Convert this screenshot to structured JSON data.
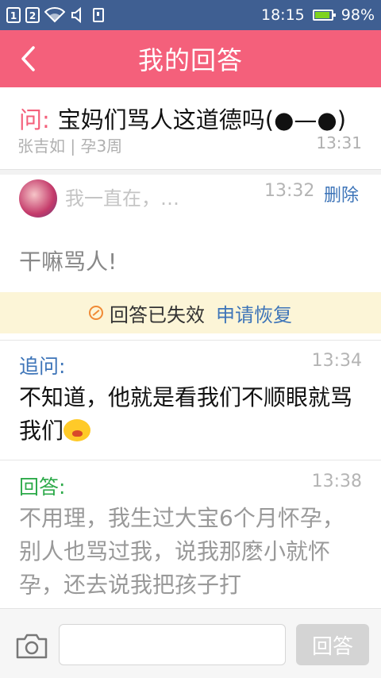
{
  "status_bar": {
    "sim1": "1",
    "sim2": "2",
    "time": "18:15",
    "battery": "98%"
  },
  "header": {
    "title": "我的回答",
    "back_icon": "chevron-left-icon"
  },
  "question": {
    "prefix": "问:",
    "text": "宝妈们骂人这道德吗(●—●)",
    "meta": "张吉如 | 孕3周",
    "time": "13:31"
  },
  "answer": {
    "author": "我一直在，…",
    "time": "13:32",
    "delete_label": "删除",
    "text": "干嘛骂人!"
  },
  "invalid_notice": {
    "text": "回答已失效",
    "restore_label": "申请恢复",
    "icon": "ban-icon"
  },
  "followup": {
    "label": "追问:",
    "time": "13:34",
    "text": "不知道，他就是看我们不顺眼就骂我们"
  },
  "reply": {
    "label": "回答:",
    "time": "13:38",
    "text": "不用理，我生过大宝6个月怀孕，别人也骂过我，说我那麽小就怀孕，还去说我把孩子打"
  },
  "composer": {
    "placeholder": "",
    "button_label": "回答",
    "camera_icon": "camera-icon"
  },
  "colors": {
    "header": "#f4607b",
    "status_bar": "#3f5f92",
    "link": "#3d74b8",
    "reply_label": "#2daa4a"
  }
}
